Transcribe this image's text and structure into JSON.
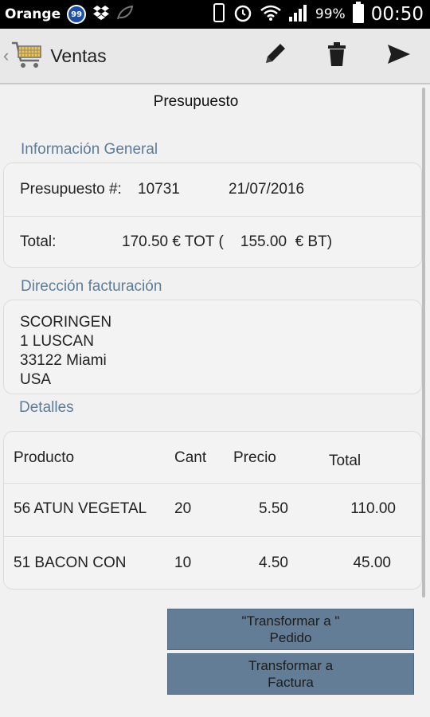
{
  "status_bar": {
    "carrier": "Orange",
    "notification_count": "99",
    "battery": "99%",
    "time": "00:50"
  },
  "action_bar": {
    "title": "Ventas",
    "actions": [
      "edit",
      "delete",
      "send"
    ]
  },
  "page": {
    "heading": "Presupuesto"
  },
  "general": {
    "title": "Información General",
    "doc_label": "Presupuesto #:",
    "doc_number": "10731",
    "date": "21/07/2016",
    "total_label": "Total:",
    "total_value": "170.50 € TOT (    155.00  € BT)"
  },
  "billing": {
    "title": "Dirección facturación",
    "lines": [
      "SCORINGEN",
      "1 LUSCAN",
      "33122 Miami",
      "USA"
    ]
  },
  "details": {
    "title": "Detalles",
    "columns": [
      "Producto",
      "Cant",
      "Precio",
      "Total"
    ],
    "rows": [
      {
        "product": "56 ATUN VEGETAL",
        "qty": "20",
        "price": "5.50",
        "total": "110.00"
      },
      {
        "product": "51 BACON CON",
        "qty": "10",
        "price": "4.50",
        "total": "45.00"
      }
    ]
  },
  "buttons": {
    "to_order": "\"Transformar a \" Pedido",
    "to_invoice": "Transformar a Factura"
  },
  "colors": {
    "section_title": "#5c7c99",
    "button_bg": "#637d97",
    "action_bar": "#e8e8e8"
  }
}
